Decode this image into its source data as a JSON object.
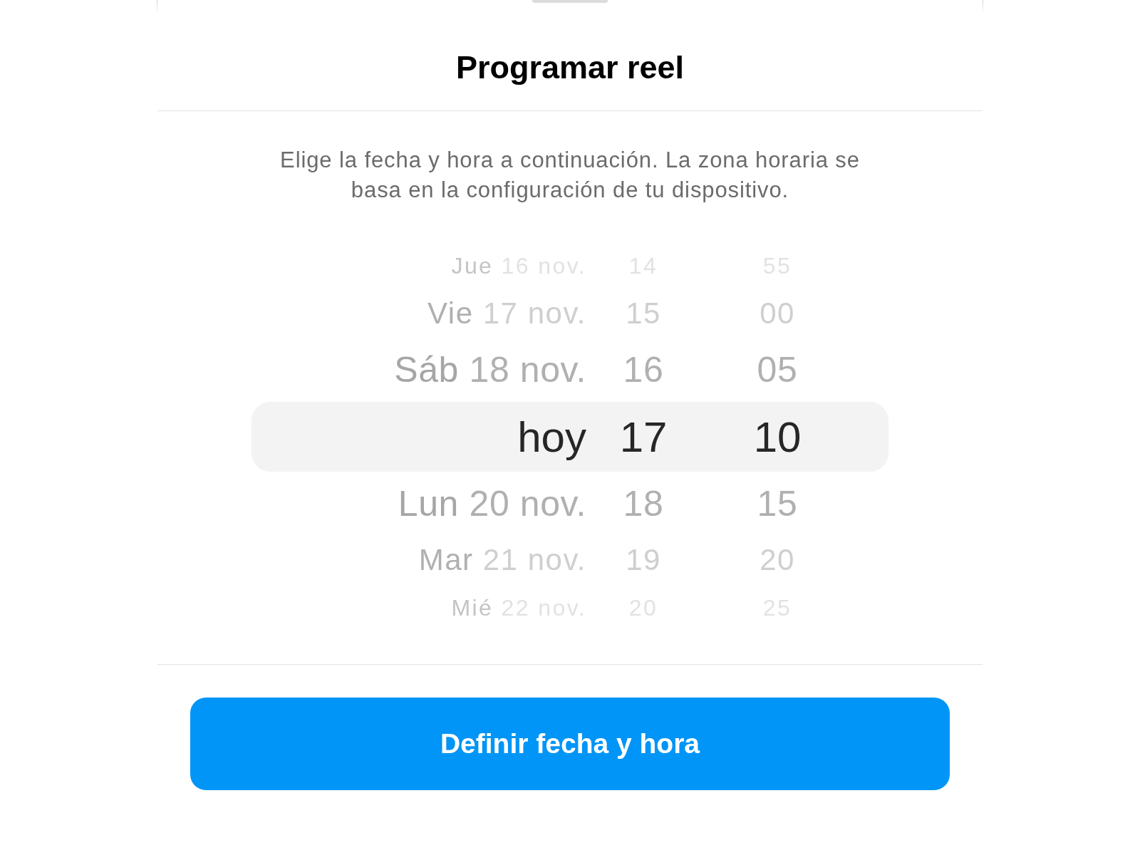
{
  "title": "Programar reel",
  "description": "Elige la fecha y hora a continuación. La zona horaria se basa en la configuración de tu dispositivo.",
  "picker": {
    "rows": [
      {
        "weekday": "Jue",
        "date": "16 nov.",
        "hour": "14",
        "minute": "55",
        "selected": false
      },
      {
        "weekday": "Vie",
        "date": "17 nov.",
        "hour": "15",
        "minute": "00",
        "selected": false
      },
      {
        "weekday": "Sáb",
        "date": "18 nov.",
        "hour": "16",
        "minute": "05",
        "selected": false
      },
      {
        "weekday": "hoy",
        "hour": "17",
        "minute": "10",
        "selected": true
      },
      {
        "weekday": "Lun",
        "date": "20 nov.",
        "hour": "18",
        "minute": "15",
        "selected": false
      },
      {
        "weekday": "Mar",
        "date": "21 nov.",
        "hour": "19",
        "minute": "20",
        "selected": false
      },
      {
        "weekday": "Mié",
        "date": "22 nov.",
        "hour": "20",
        "minute": "25",
        "selected": false
      }
    ]
  },
  "button": "Definir fecha y hora"
}
